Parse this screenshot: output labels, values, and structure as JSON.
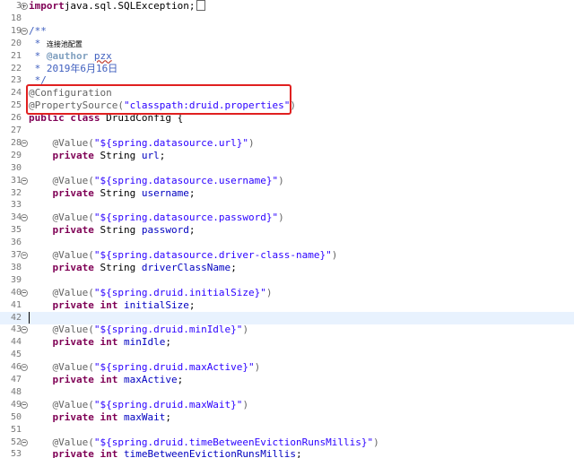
{
  "editor": {
    "lines": [
      {
        "num": "3",
        "fold": "plus",
        "parts": [
          [
            "kw",
            "import"
          ],
          [
            "",
            "java.sql.SQLException;"
          ]
        ],
        "collapsed": true
      },
      {
        "num": "18",
        "parts": []
      },
      {
        "num": "19",
        "fold": "minus",
        "parts": [
          [
            "cmt",
            "/**"
          ]
        ]
      },
      {
        "num": "20",
        "parts": [
          [
            "cmt",
            " * "
          ],
          [
            "cmt-small",
            "连接池配置"
          ]
        ]
      },
      {
        "num": "21",
        "parts": [
          [
            "cmt",
            " * "
          ],
          [
            "tag",
            "@author"
          ],
          [
            "cmt",
            " "
          ],
          [
            "cmt squiggle",
            "pzx"
          ]
        ]
      },
      {
        "num": "22",
        "parts": [
          [
            "cmt",
            " * 2019年6月16日"
          ]
        ]
      },
      {
        "num": "23",
        "parts": [
          [
            "cmt",
            " */"
          ]
        ]
      },
      {
        "num": "24",
        "parts": [
          [
            "ann",
            "@Configuration"
          ]
        ]
      },
      {
        "num": "25",
        "parts": [
          [
            "ann",
            "@PropertySource("
          ],
          [
            "str",
            "\"classpath:druid.properties\""
          ],
          [
            "ann",
            ")"
          ]
        ]
      },
      {
        "num": "26",
        "parts": [
          [
            "kw",
            "public class"
          ],
          [
            "",
            " DruidConfig {"
          ]
        ]
      },
      {
        "num": "27",
        "parts": []
      },
      {
        "num": "28",
        "fold": "minus",
        "parts": [
          [
            "",
            "    "
          ],
          [
            "ann",
            "@Value("
          ],
          [
            "str",
            "\"${spring.datasource.url}\""
          ],
          [
            "ann",
            ")"
          ]
        ]
      },
      {
        "num": "29",
        "parts": [
          [
            "",
            "    "
          ],
          [
            "kw",
            "private"
          ],
          [
            "",
            " String "
          ],
          [
            "field",
            "url"
          ],
          [
            "",
            ";"
          ]
        ]
      },
      {
        "num": "30",
        "parts": []
      },
      {
        "num": "31",
        "fold": "minus",
        "parts": [
          [
            "",
            "    "
          ],
          [
            "ann",
            "@Value("
          ],
          [
            "str",
            "\"${spring.datasource.username}\""
          ],
          [
            "ann",
            ")"
          ]
        ]
      },
      {
        "num": "32",
        "parts": [
          [
            "",
            "    "
          ],
          [
            "kw",
            "private"
          ],
          [
            "",
            " String "
          ],
          [
            "field",
            "username"
          ],
          [
            "",
            ";"
          ]
        ]
      },
      {
        "num": "33",
        "parts": []
      },
      {
        "num": "34",
        "fold": "minus",
        "parts": [
          [
            "",
            "    "
          ],
          [
            "ann",
            "@Value("
          ],
          [
            "str",
            "\"${spring.datasource.password}\""
          ],
          [
            "ann",
            ")"
          ]
        ]
      },
      {
        "num": "35",
        "parts": [
          [
            "",
            "    "
          ],
          [
            "kw",
            "private"
          ],
          [
            "",
            " String "
          ],
          [
            "field",
            "password"
          ],
          [
            "",
            ";"
          ]
        ]
      },
      {
        "num": "36",
        "parts": []
      },
      {
        "num": "37",
        "fold": "minus",
        "parts": [
          [
            "",
            "    "
          ],
          [
            "ann",
            "@Value("
          ],
          [
            "str",
            "\"${spring.datasource.driver-class-name}\""
          ],
          [
            "ann",
            ")"
          ]
        ]
      },
      {
        "num": "38",
        "parts": [
          [
            "",
            "    "
          ],
          [
            "kw",
            "private"
          ],
          [
            "",
            " String "
          ],
          [
            "field",
            "driverClassName"
          ],
          [
            "",
            ";"
          ]
        ]
      },
      {
        "num": "39",
        "parts": []
      },
      {
        "num": "40",
        "fold": "minus",
        "parts": [
          [
            "",
            "    "
          ],
          [
            "ann",
            "@Value("
          ],
          [
            "str",
            "\"${spring.druid.initialSize}\""
          ],
          [
            "ann",
            ")"
          ]
        ]
      },
      {
        "num": "41",
        "parts": [
          [
            "",
            "    "
          ],
          [
            "kw",
            "private int"
          ],
          [
            "",
            " "
          ],
          [
            "field",
            "initialSize"
          ],
          [
            "",
            ";"
          ]
        ]
      },
      {
        "num": "42",
        "parts": [],
        "current": true
      },
      {
        "num": "43",
        "fold": "minus",
        "parts": [
          [
            "",
            "    "
          ],
          [
            "ann",
            "@Value("
          ],
          [
            "str",
            "\"${spring.druid.minIdle}\""
          ],
          [
            "ann",
            ")"
          ]
        ]
      },
      {
        "num": "44",
        "parts": [
          [
            "",
            "    "
          ],
          [
            "kw",
            "private int"
          ],
          [
            "",
            " "
          ],
          [
            "field",
            "minIdle"
          ],
          [
            "",
            ";"
          ]
        ]
      },
      {
        "num": "45",
        "parts": []
      },
      {
        "num": "46",
        "fold": "minus",
        "parts": [
          [
            "",
            "    "
          ],
          [
            "ann",
            "@Value("
          ],
          [
            "str",
            "\"${spring.druid.maxActive}\""
          ],
          [
            "ann",
            ")"
          ]
        ]
      },
      {
        "num": "47",
        "parts": [
          [
            "",
            "    "
          ],
          [
            "kw",
            "private int"
          ],
          [
            "",
            " "
          ],
          [
            "field",
            "maxActive"
          ],
          [
            "",
            ";"
          ]
        ]
      },
      {
        "num": "48",
        "parts": []
      },
      {
        "num": "49",
        "fold": "minus",
        "parts": [
          [
            "",
            "    "
          ],
          [
            "ann",
            "@Value("
          ],
          [
            "str",
            "\"${spring.druid.maxWait}\""
          ],
          [
            "ann",
            ")"
          ]
        ]
      },
      {
        "num": "50",
        "parts": [
          [
            "",
            "    "
          ],
          [
            "kw",
            "private int"
          ],
          [
            "",
            " "
          ],
          [
            "field",
            "maxWait"
          ],
          [
            "",
            ";"
          ]
        ]
      },
      {
        "num": "51",
        "parts": []
      },
      {
        "num": "52",
        "fold": "minus",
        "parts": [
          [
            "",
            "    "
          ],
          [
            "ann",
            "@Value("
          ],
          [
            "str",
            "\"${spring.druid.timeBetweenEvictionRunsMillis}\""
          ],
          [
            "ann",
            ")"
          ]
        ]
      },
      {
        "num": "53",
        "parts": [
          [
            "",
            "    "
          ],
          [
            "kw",
            "private int"
          ],
          [
            "",
            " "
          ],
          [
            "field",
            "timeBetweenEvictionRunsMillis"
          ],
          [
            "",
            ";"
          ]
        ]
      }
    ]
  },
  "colors": {
    "keyword": "#7f0055",
    "string": "#2a00ff",
    "annotation": "#646464",
    "comment": "#3f5fbf",
    "field": "#0000c0",
    "highlight_box": "#e02020",
    "current_line": "#e8f2fe"
  },
  "icons": {
    "fold_expand": "fold-plus-icon",
    "fold_collapse": "fold-minus-icon"
  }
}
